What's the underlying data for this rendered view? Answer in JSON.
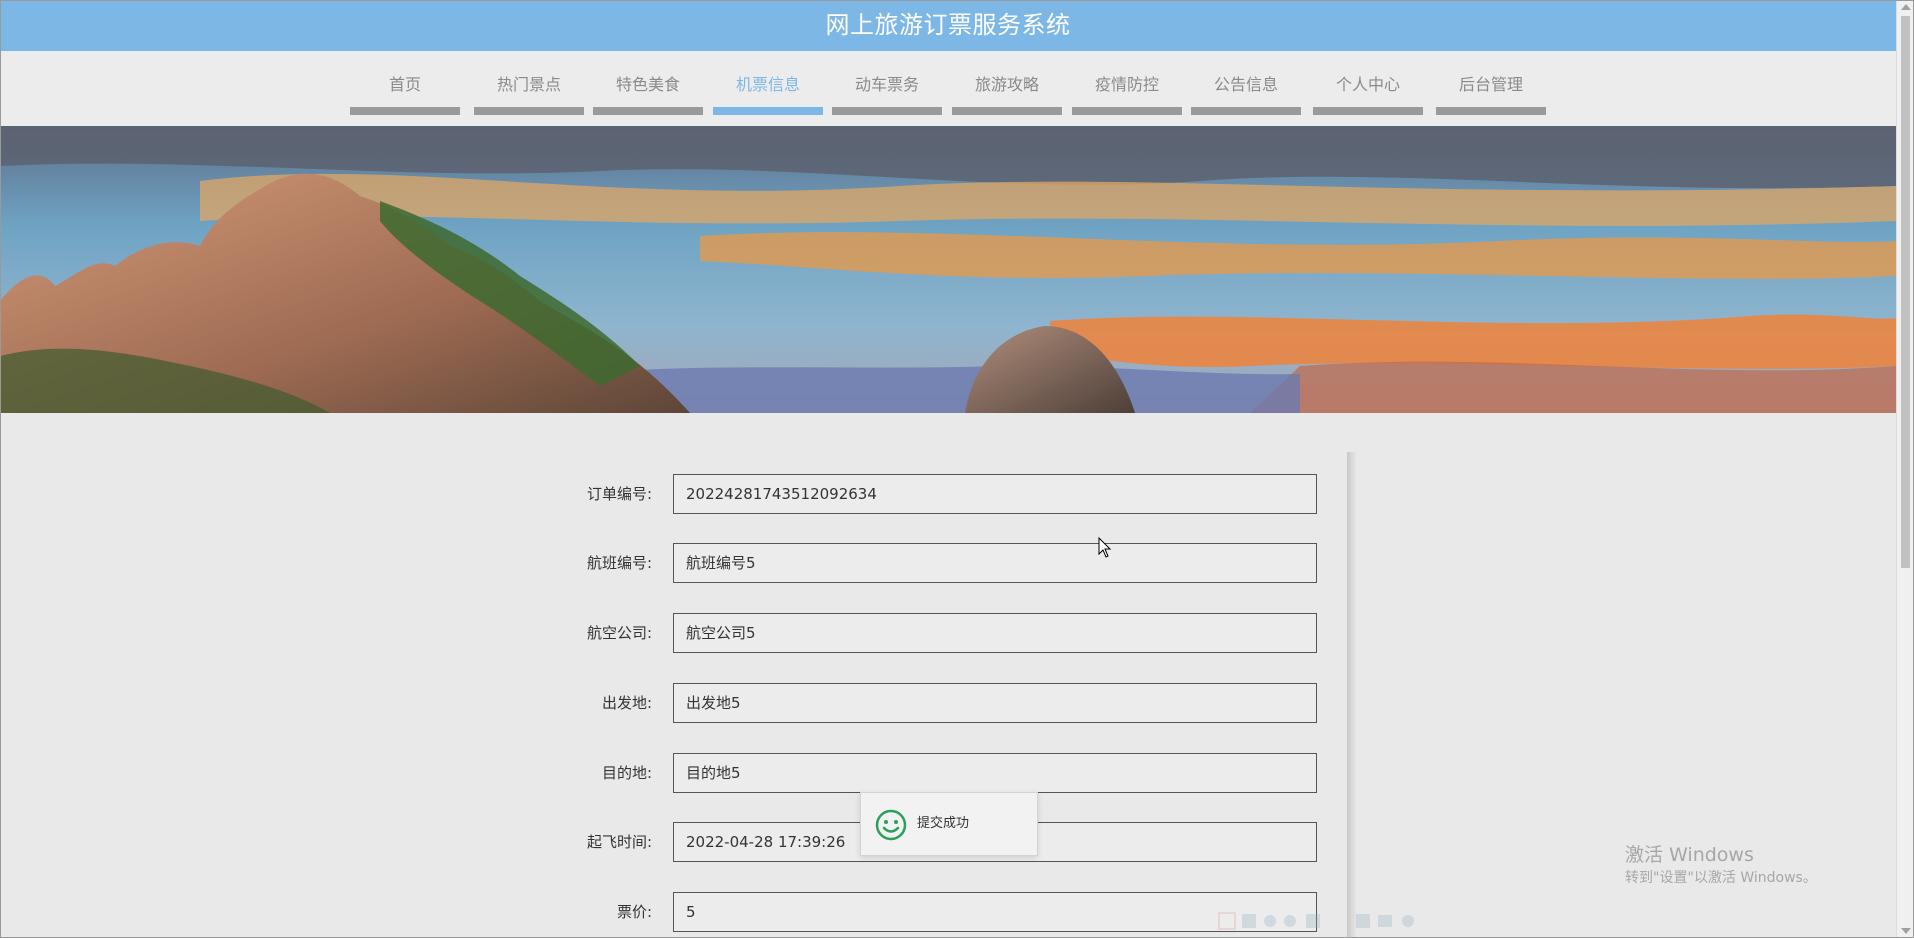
{
  "app": {
    "title": "网上旅游订票服务系统"
  },
  "nav": {
    "items": [
      {
        "label": "首页",
        "active": false
      },
      {
        "label": "热门景点",
        "active": false
      },
      {
        "label": "特色美食",
        "active": false
      },
      {
        "label": "机票信息",
        "active": true
      },
      {
        "label": "动车票务",
        "active": false
      },
      {
        "label": "旅游攻略",
        "active": false
      },
      {
        "label": "疫情防控",
        "active": false
      },
      {
        "label": "公告信息",
        "active": false
      },
      {
        "label": "个人中心",
        "active": false
      },
      {
        "label": "后台管理",
        "active": false
      }
    ]
  },
  "form": {
    "fields": [
      {
        "label": "订单编号:",
        "value": "20224281743512092634"
      },
      {
        "label": "航班编号:",
        "value": "航班编号5"
      },
      {
        "label": "航空公司:",
        "value": "航空公司5"
      },
      {
        "label": "出发地:",
        "value": "出发地5"
      },
      {
        "label": "目的地:",
        "value": "目的地5"
      },
      {
        "label": "起飞时间:",
        "value": "2022-04-28 17:39:26"
      },
      {
        "label": "票价:",
        "value": "5"
      }
    ]
  },
  "toast": {
    "message": "提交成功",
    "icon": "smile-icon"
  },
  "watermark": {
    "title": "激活 Windows",
    "subtitle": "转到\"设置\"以激活 Windows。"
  },
  "colors": {
    "header": "#7db7e6",
    "active": "#7db7e6",
    "inactive": "#8a8a8a",
    "underline": "#9a9a9a",
    "toast_icon": "#2aa05a"
  }
}
